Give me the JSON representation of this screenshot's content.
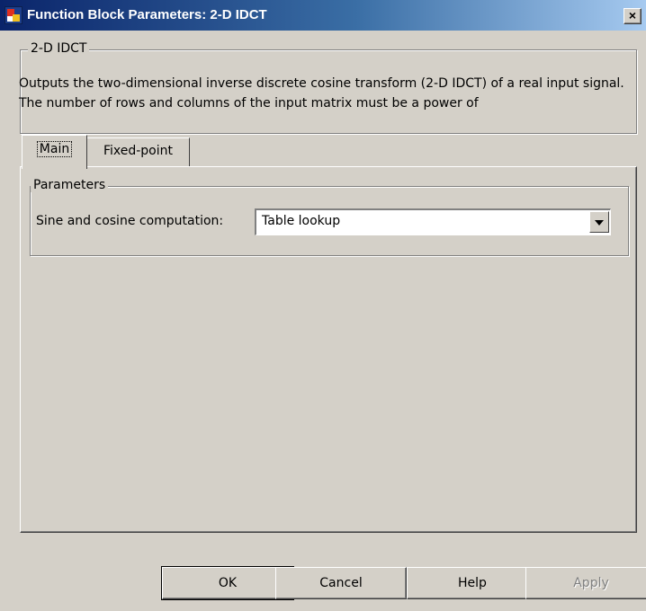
{
  "window": {
    "title": "Function Block Parameters: 2-D IDCT",
    "close_glyph": "×",
    "app_icon": "simulink-block-icon"
  },
  "description": {
    "legend": "2-D IDCT",
    "text": "Outputs the two-dimensional inverse discrete cosine transform (2-D IDCT) of a real input signal. The number of rows and columns of the input matrix must be a power of"
  },
  "tabs": [
    {
      "label": "Main",
      "selected": true
    },
    {
      "label": "Fixed-point",
      "selected": false
    }
  ],
  "parameters": {
    "legend": "Parameters",
    "sine_cosine": {
      "label": "Sine and cosine computation:",
      "value": "Table lookup"
    }
  },
  "buttons": {
    "ok": "OK",
    "cancel": "Cancel",
    "help": "Help",
    "apply": "Apply"
  }
}
